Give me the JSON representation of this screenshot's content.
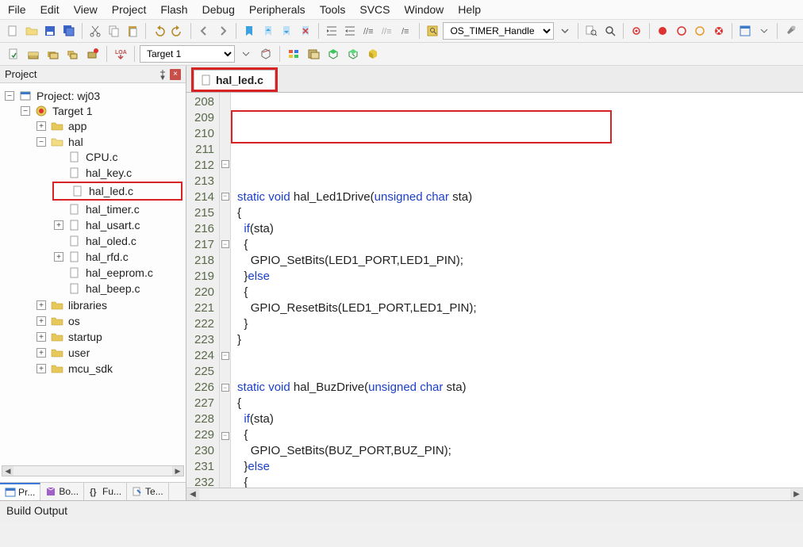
{
  "menu": {
    "items": [
      "File",
      "Edit",
      "View",
      "Project",
      "Flash",
      "Debug",
      "Peripherals",
      "Tools",
      "SVCS",
      "Window",
      "Help"
    ]
  },
  "toolbar1": {
    "combo_symbol_value": "OS_TIMER_Handle"
  },
  "toolbar2": {
    "target_value": "Target 1"
  },
  "project_panel": {
    "title": "Project",
    "root_label": "Project: wj03",
    "target_label": "Target 1",
    "folders": {
      "app": "app",
      "hal": "hal",
      "libraries": "libraries",
      "os": "os",
      "startup": "startup",
      "user": "user",
      "mcu_sdk": "mcu_sdk"
    },
    "hal_files": [
      "CPU.c",
      "hal_key.c",
      "hal_led.c",
      "hal_timer.c",
      "hal_usart.c",
      "hal_oled.c",
      "hal_rfd.c",
      "hal_eeprom.c",
      "hal_beep.c"
    ],
    "tabs": {
      "project_short": "Pr...",
      "books_short": "Bo...",
      "functions_short": "Fu...",
      "templates_short": "Te..."
    }
  },
  "editor": {
    "active_tab": "hal_led.c",
    "code_lines": [
      {
        "n": 208,
        "fold": "",
        "txt": ""
      },
      {
        "n": 209,
        "fold": "",
        "txt": ""
      },
      {
        "n": 210,
        "fold": "",
        "txt": ""
      },
      {
        "n": 211,
        "fold": "",
        "txt": "static void hal_Led1Drive(unsigned char sta)"
      },
      {
        "n": 212,
        "fold": "⊟",
        "txt": "{"
      },
      {
        "n": 213,
        "fold": "",
        "txt": "  if(sta)"
      },
      {
        "n": 214,
        "fold": "⊟",
        "txt": "  {"
      },
      {
        "n": 215,
        "fold": "",
        "txt": "    GPIO_SetBits(LED1_PORT,LED1_PIN);"
      },
      {
        "n": 216,
        "fold": "",
        "txt": "  }else"
      },
      {
        "n": 217,
        "fold": "⊟",
        "txt": "  {"
      },
      {
        "n": 218,
        "fold": "",
        "txt": "    GPIO_ResetBits(LED1_PORT,LED1_PIN);"
      },
      {
        "n": 219,
        "fold": "",
        "txt": "  }"
      },
      {
        "n": 220,
        "fold": "",
        "txt": "}"
      },
      {
        "n": 221,
        "fold": "",
        "txt": ""
      },
      {
        "n": 222,
        "fold": "",
        "txt": ""
      },
      {
        "n": 223,
        "fold": "",
        "txt": "static void hal_BuzDrive(unsigned char sta)"
      },
      {
        "n": 224,
        "fold": "⊟",
        "txt": "{"
      },
      {
        "n": 225,
        "fold": "",
        "txt": "  if(sta)"
      },
      {
        "n": 226,
        "fold": "⊟",
        "txt": "  {"
      },
      {
        "n": 227,
        "fold": "",
        "txt": "    GPIO_SetBits(BUZ_PORT,BUZ_PIN);"
      },
      {
        "n": 228,
        "fold": "",
        "txt": "  }else"
      },
      {
        "n": 229,
        "fold": "⊟",
        "txt": "  {"
      },
      {
        "n": 230,
        "fold": "",
        "txt": "    GPIO_ResetBits(BUZ_PORT,BUZ_PIN);"
      },
      {
        "n": 231,
        "fold": "",
        "txt": "  }"
      },
      {
        "n": 232,
        "fold": "",
        "txt": "}"
      }
    ]
  },
  "output": {
    "title": "Build Output"
  }
}
